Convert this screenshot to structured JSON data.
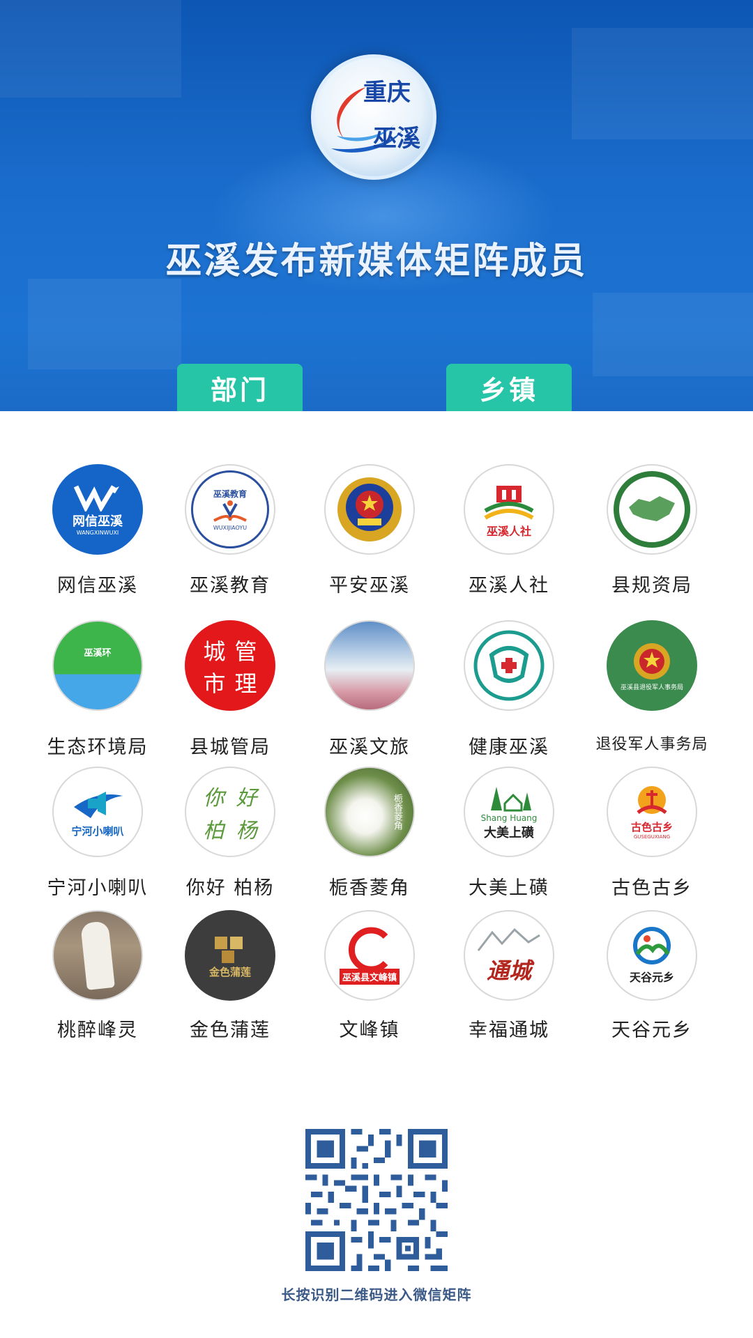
{
  "header": {
    "logo_text_1": "重庆",
    "logo_text_2": "巫溪",
    "title": "巫溪发布新媒体矩阵成员"
  },
  "tabs": [
    {
      "label": "部门"
    },
    {
      "label": "乡镇"
    }
  ],
  "grid": {
    "items": [
      {
        "label": "网信巫溪",
        "icon": "wangxin-logo-icon",
        "inner_text": "网信巫溪",
        "inner_sub": "WANGXINWUXI"
      },
      {
        "label": "巫溪教育",
        "icon": "education-book-icon",
        "inner_text": "巫溪教育",
        "inner_sub": "WUXIJIAOYU"
      },
      {
        "label": "平安巫溪",
        "icon": "police-emblem-icon"
      },
      {
        "label": "巫溪人社",
        "icon": "human-resources-icon",
        "inner_text": "巫溪人社"
      },
      {
        "label": "县规资局",
        "icon": "land-map-icon"
      },
      {
        "label": "生态环境局",
        "icon": "ecology-mountain-icon",
        "inner_text": "巫溪环"
      },
      {
        "label": "县城管局",
        "icon": "city-management-icon",
        "inner_chars": [
          "城",
          "管",
          "市",
          "理"
        ]
      },
      {
        "label": "巫溪文旅",
        "icon": "landscape-photo-icon"
      },
      {
        "label": "健康巫溪",
        "icon": "health-emblem-icon"
      },
      {
        "label": "退役军人事务局",
        "icon": "veterans-emblem-icon",
        "inner_text": "巫溪县退役军人事务局"
      },
      {
        "label": "宁河小喇叭",
        "icon": "megaphone-icon",
        "inner_text": "宁河小喇叭"
      },
      {
        "label": "你好 柏杨",
        "icon": "calligraphy-icon",
        "inner_chars": [
          "你",
          "好",
          "柏",
          "杨"
        ]
      },
      {
        "label": "栀香菱角",
        "icon": "gardenia-flower-icon",
        "inner_text": "栀香菱角"
      },
      {
        "label": "大美上磺",
        "icon": "trees-village-icon",
        "inner_text": "大美上磺",
        "inner_sub": "Shang Huang"
      },
      {
        "label": "古色古乡",
        "icon": "ancient-town-icon",
        "inner_text": "古色古乡",
        "inner_sub": "GUSEGUXIANG"
      },
      {
        "label": "桃醉峰灵",
        "icon": "stone-monument-icon"
      },
      {
        "label": "金色蒲莲",
        "icon": "golden-lotus-icon",
        "inner_text": "金色蒲莲"
      },
      {
        "label": "文峰镇",
        "icon": "wenfeng-logo-icon",
        "inner_text": "巫溪县文峰镇"
      },
      {
        "label": "幸福通城",
        "icon": "tongcheng-calligraphy-icon",
        "inner_text": "通城"
      },
      {
        "label": "天谷元乡",
        "icon": "tiangu-logo-icon",
        "inner_text": "天谷元乡"
      }
    ]
  },
  "qr": {
    "caption": "长按识别二维码进入微信矩阵"
  },
  "colors": {
    "header_blue": "#1b6bc6",
    "tab_green": "#27c5a8",
    "caption_blue": "#3c5a87"
  }
}
